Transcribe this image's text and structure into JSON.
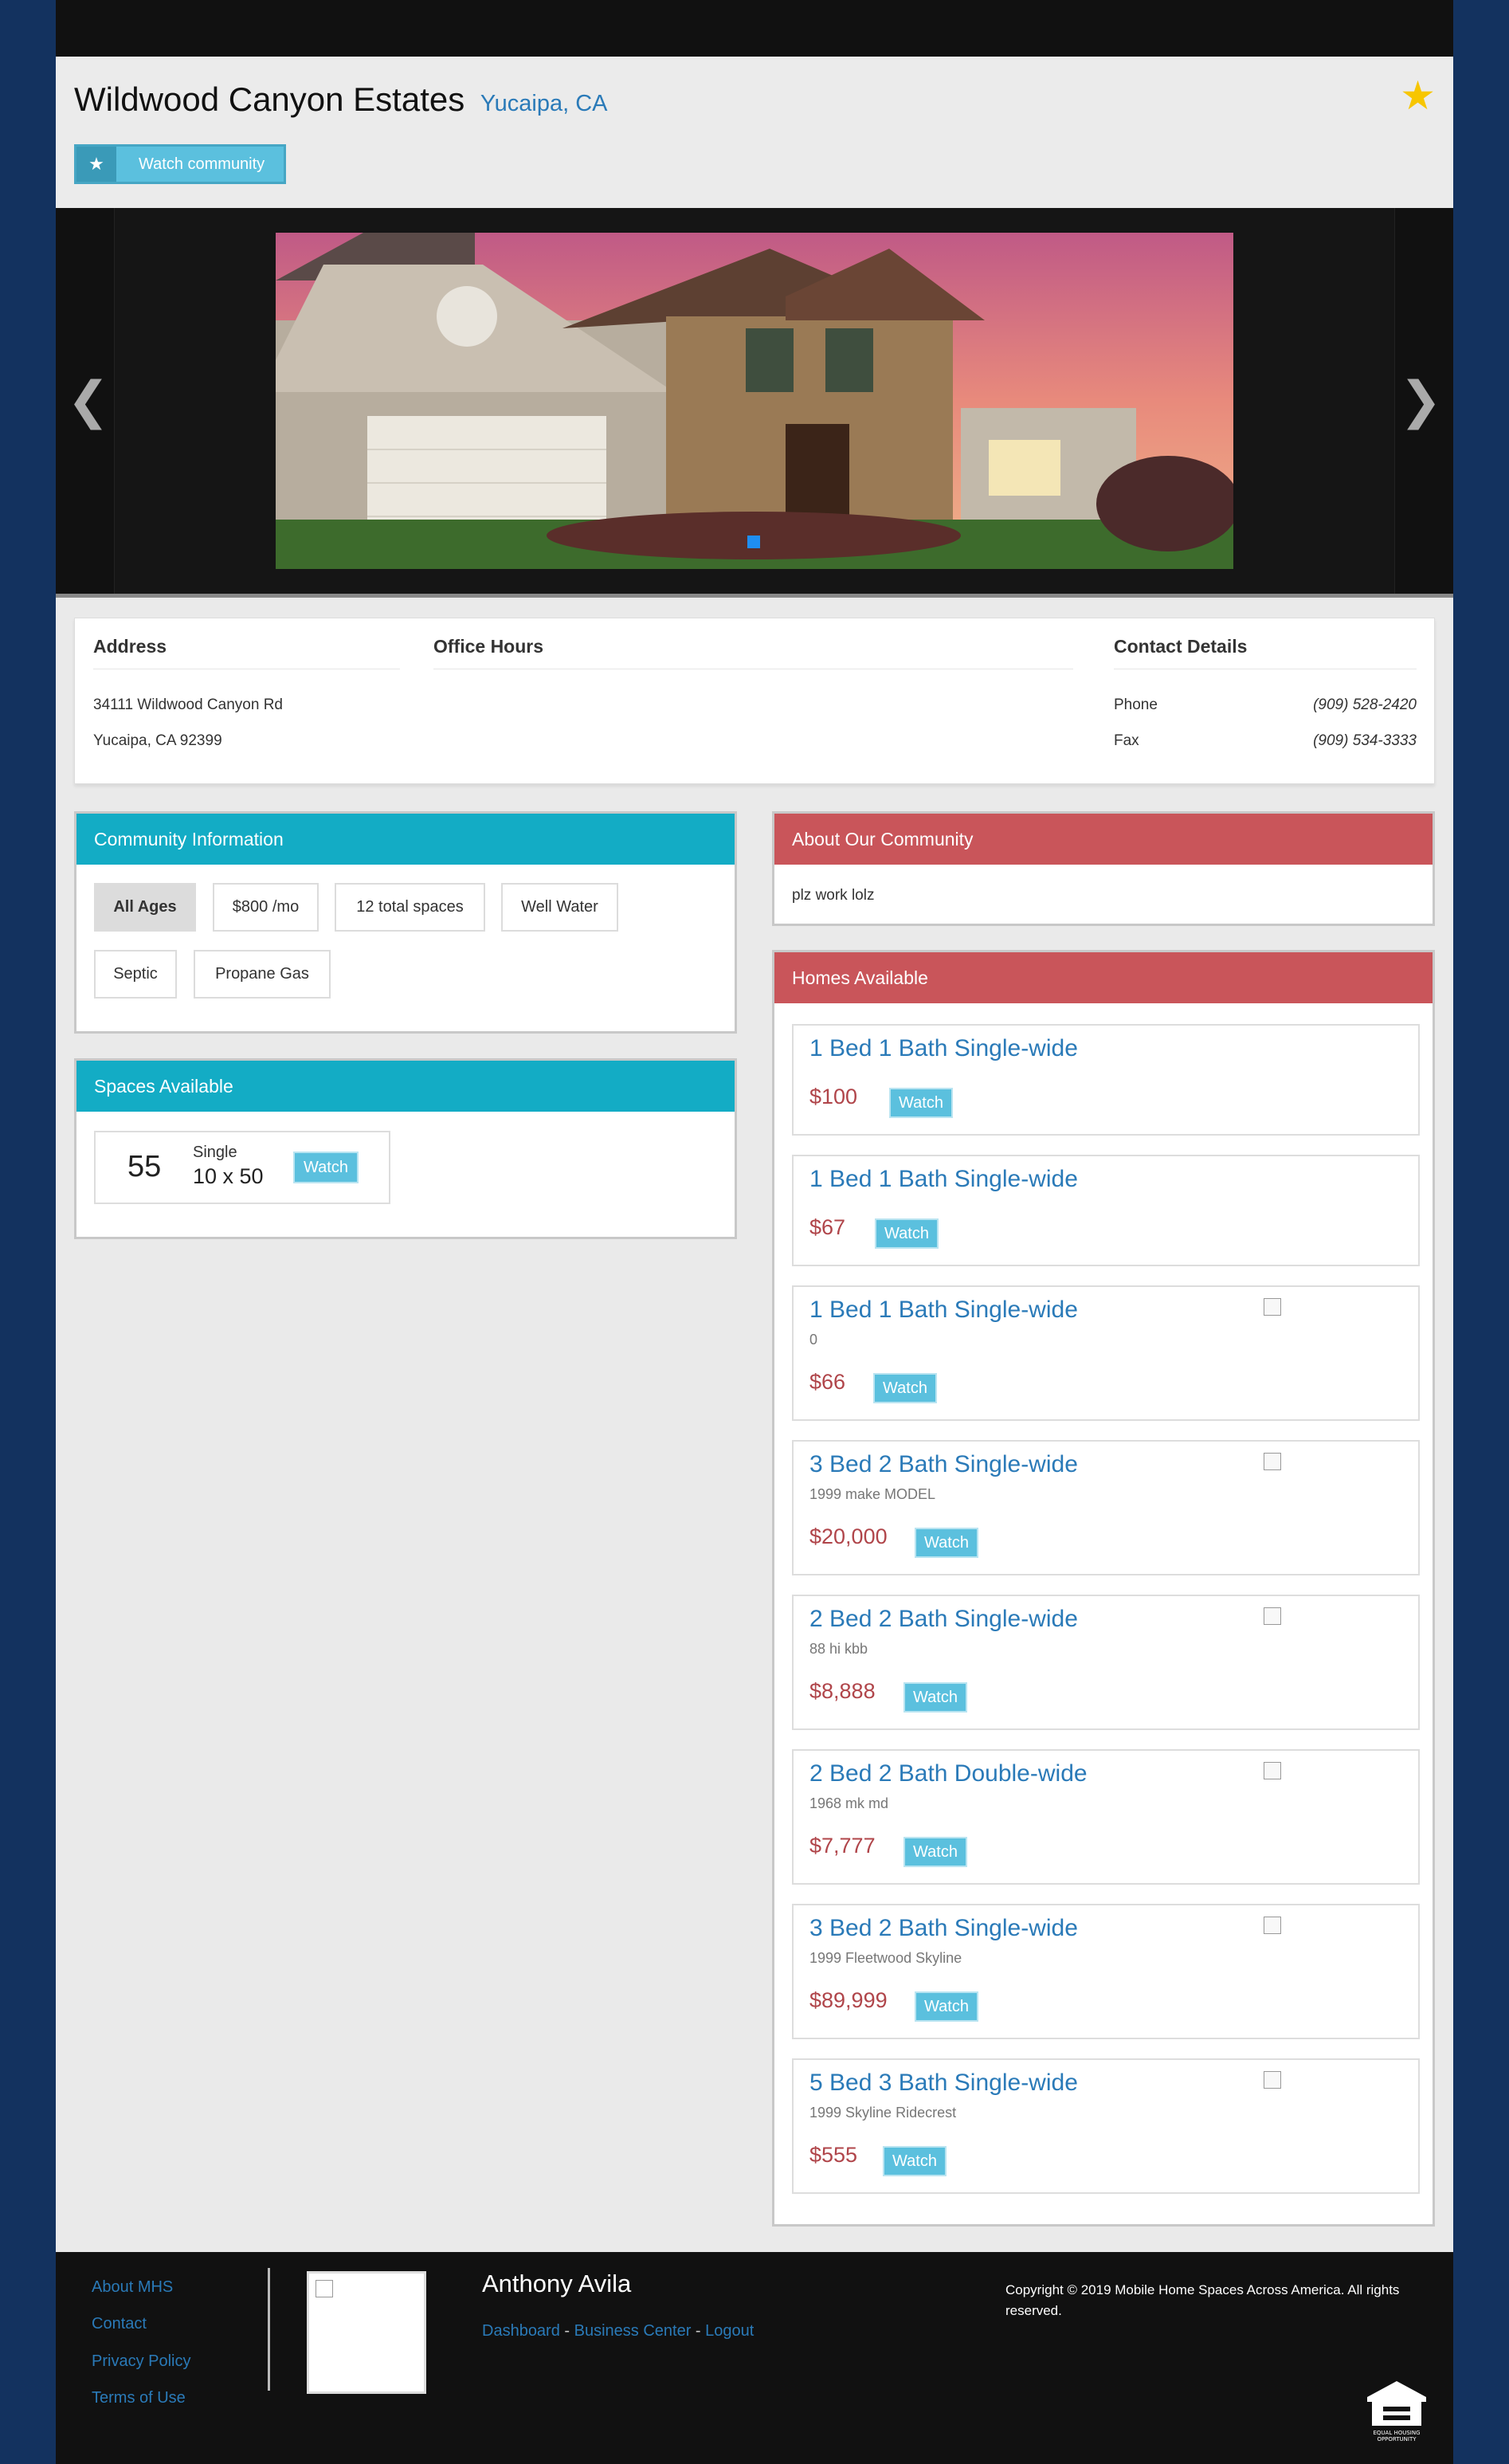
{
  "community": {
    "name": "Wildwood Canyon Estates",
    "location": "Yucaipa, CA",
    "watch_label": "Watch community"
  },
  "info": {
    "address_heading": "Address",
    "address_line1": "34111 Wildwood Canyon Rd",
    "address_line2": "Yucaipa, CA 92399",
    "hours_heading": "Office Hours",
    "contact_heading": "Contact Details",
    "phone_label": "Phone",
    "phone_value": "(909) 528-2420",
    "fax_label": "Fax",
    "fax_value": "(909) 534-3333"
  },
  "community_info": {
    "heading": "Community Information",
    "tags": [
      "All Ages",
      "$800 /mo",
      "12 total spaces",
      "Well Water",
      "Septic",
      "Propane Gas"
    ]
  },
  "spaces": {
    "heading": "Spaces Available",
    "items": [
      {
        "number": "55",
        "type": "Single",
        "size": "10 x 50",
        "watch": "Watch"
      }
    ]
  },
  "about": {
    "heading": "About Our Community",
    "text": "plz work lolz"
  },
  "homes": {
    "heading": "Homes Available",
    "items": [
      {
        "title": "1 Bed 1 Bath Single-wide",
        "sub": "",
        "price": "$100",
        "watch": "Watch"
      },
      {
        "title": "1 Bed 1 Bath Single-wide",
        "sub": "",
        "price": "$67",
        "watch": "Watch"
      },
      {
        "title": "1 Bed 1 Bath Single-wide",
        "sub": "0",
        "price": "$66",
        "watch": "Watch"
      },
      {
        "title": "3 Bed 2 Bath Single-wide",
        "sub": "1999 make MODEL",
        "price": "$20,000",
        "watch": "Watch"
      },
      {
        "title": "2 Bed 2 Bath Single-wide",
        "sub": "88 hi kbb",
        "price": "$8,888",
        "watch": "Watch"
      },
      {
        "title": "2 Bed 2 Bath Double-wide",
        "sub": "1968 mk md",
        "price": "$7,777",
        "watch": "Watch"
      },
      {
        "title": "3 Bed 2 Bath Single-wide",
        "sub": "1999 Fleetwood Skyline",
        "price": "$89,999",
        "watch": "Watch"
      },
      {
        "title": "5 Bed 3 Bath Single-wide",
        "sub": "1999 Skyline Ridecrest",
        "price": "$555",
        "watch": "Watch"
      }
    ]
  },
  "footer": {
    "links": [
      "About MHS",
      "Contact",
      "Privacy Policy",
      "Terms of Use"
    ],
    "user_name": "Anthony Avila",
    "nav": [
      "Dashboard",
      "Business Center",
      "Logout"
    ],
    "nav_sep": " - ",
    "copyright": "Copyright © 2019 Mobile Home Spaces Across America. All rights reserved.",
    "eho_line1": "EQUAL HOUSING",
    "eho_line2": "OPPORTUNITY"
  },
  "icons": {
    "favorite": "star-icon",
    "prev": "chevron-left-icon",
    "next": "chevron-right-icon"
  },
  "colors": {
    "accent_teal": "#13acc5",
    "accent_red": "#c9555a",
    "link_blue": "#2a7ab8",
    "watch_button": "#5bc0de",
    "price_red": "#b0454a"
  }
}
